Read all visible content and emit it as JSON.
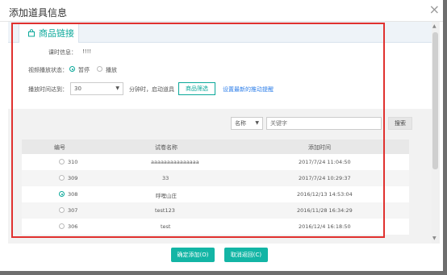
{
  "dialog": {
    "title": "添加道具信息",
    "close_glyph": "×"
  },
  "tab": {
    "label": "商品链接",
    "icon": "shopping-bag-icon",
    "accent": "#0aa89a"
  },
  "form": {
    "lesson_info_label": "课时信息：",
    "lesson_info_value": "!!!!",
    "video_state_label": "视频播放状态：",
    "video_state_options": [
      {
        "label": "暂停",
        "selected": true
      },
      {
        "label": "播放",
        "selected": false
      }
    ],
    "play_time_label": "播放时间达到：",
    "play_time_value": "30",
    "play_time_suffix": "分钟时，启动道具",
    "select_goods_button": "商品筛选",
    "link_text": "设置最新的推动提醒"
  },
  "search": {
    "field_select": "名称",
    "placeholder": "关键字",
    "button": "搜索"
  },
  "table": {
    "columns": [
      "编号",
      "试卷名称",
      "添加时间"
    ],
    "rows": [
      {
        "id": "310",
        "name": "aaaaaaaaaaaaaaa",
        "time": "2017/7/24 11:04:50",
        "selected": false
      },
      {
        "id": "309",
        "name": "33",
        "time": "2017/7/24 10:29:37",
        "selected": false
      },
      {
        "id": "308",
        "name": "呼哩山庄",
        "time": "2016/12/13 14:53:04",
        "selected": true
      },
      {
        "id": "307",
        "name": "test123",
        "time": "2016/11/28 16:34:29",
        "selected": false
      },
      {
        "id": "306",
        "name": "test",
        "time": "2016/12/4 16:18:50",
        "selected": false
      }
    ]
  },
  "footer": {
    "confirm_button": "确定添加(O)",
    "cancel_button": "取消返回(C)"
  },
  "colors": {
    "primary": "#13b5a5",
    "highlight_frame": "#e0312f",
    "link": "#2b7de9"
  }
}
